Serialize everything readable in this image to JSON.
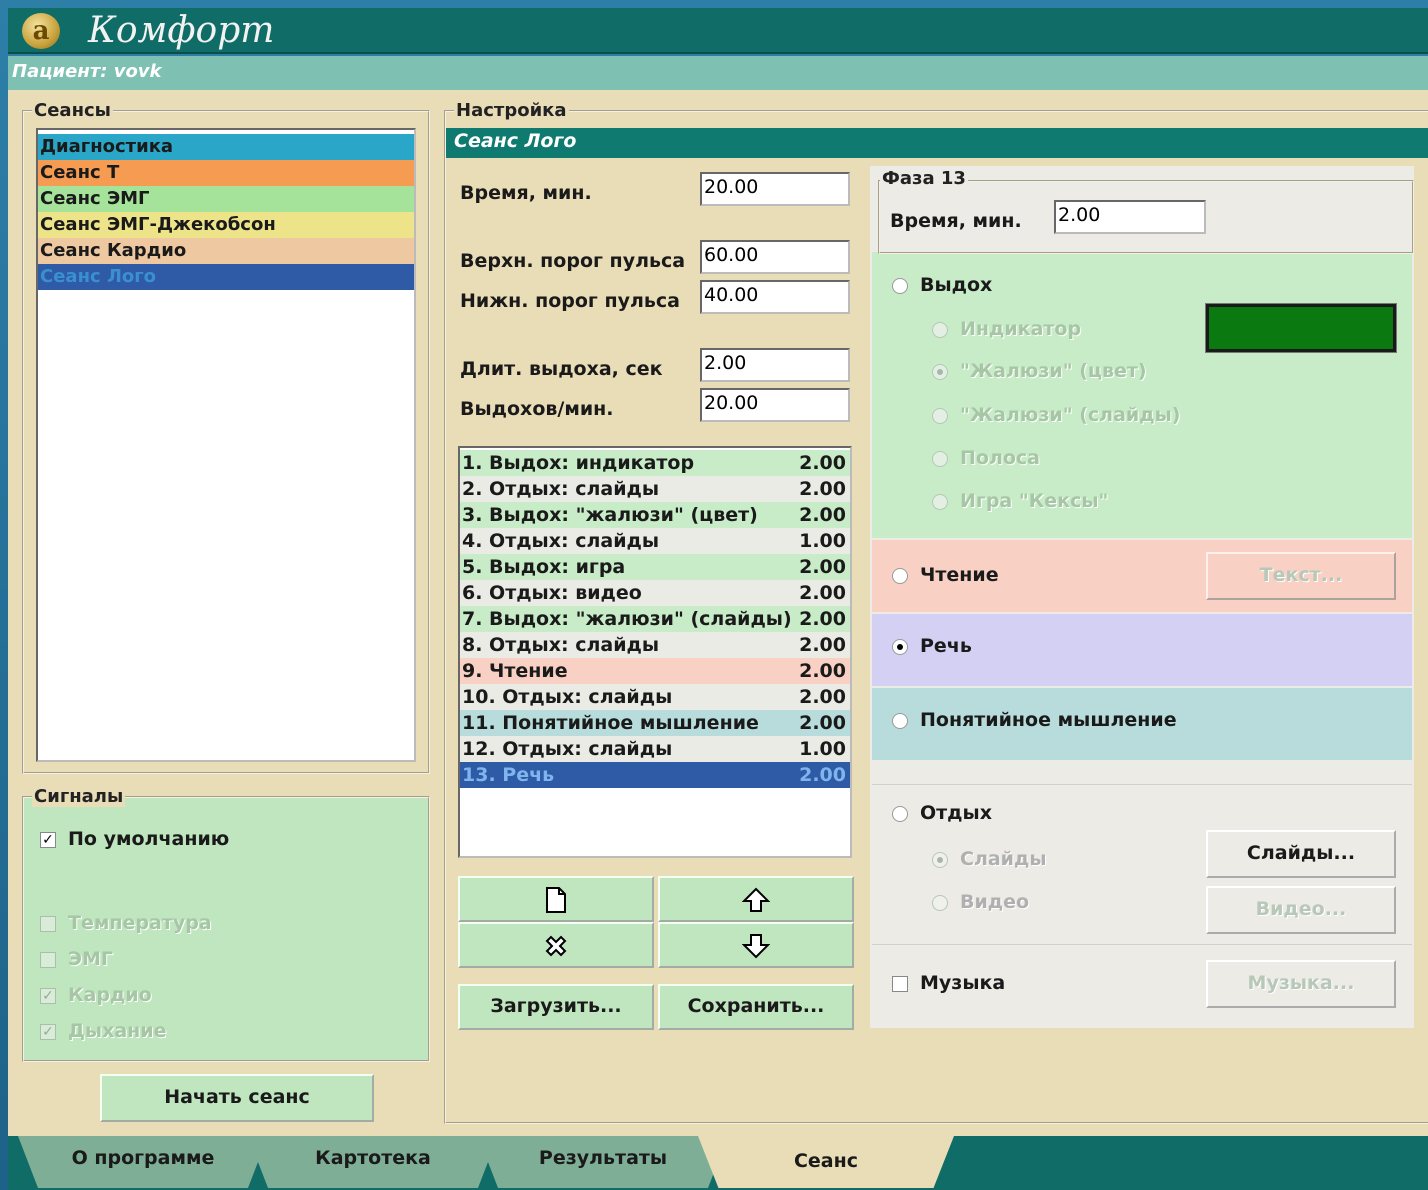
{
  "app": {
    "title": "Комфорт",
    "logo_glyph": "a",
    "patient": "Пациент: vovk"
  },
  "sessions": {
    "title": "Сеансы",
    "items": [
      {
        "label": "Диагностика",
        "color": "#2aa6c8"
      },
      {
        "label": "Сеанс Т",
        "color": "#f59b52"
      },
      {
        "label": "Сеанс ЭМГ",
        "color": "#a6e39a"
      },
      {
        "label": "Сеанс ЭМГ-Джекобсон",
        "color": "#ede48a"
      },
      {
        "label": "Сеанс Кардио",
        "color": "#eec8a0"
      },
      {
        "label": "Сеанс Лого",
        "color": "#2f5aa6",
        "selected": true
      }
    ]
  },
  "signals": {
    "title": "Сигналы",
    "default_label": "По умолчанию",
    "default_checked": true,
    "items": [
      {
        "label": "Температура",
        "checked": false
      },
      {
        "label": "ЭМГ",
        "checked": false
      },
      {
        "label": "Кардио",
        "checked": true
      },
      {
        "label": "Дыхание",
        "checked": true
      }
    ],
    "start_button": "Начать сеанс"
  },
  "settings": {
    "title": "Настройка",
    "header": "Сеанс Лого",
    "fields": {
      "time_label": "Время, мин.",
      "time_value": "20.00",
      "upper_label": "Верхн. порог пульса",
      "upper_value": "60.00",
      "lower_label": "Нижн. порог пульса",
      "lower_value": "40.00",
      "exhale_len_label": "Длит. выдоха, сек",
      "exhale_len_value": "2.00",
      "exhales_label": "Выдохов/мин.",
      "exhales_value": "20.00"
    },
    "phases": [
      {
        "label": "1. Выдох: индикатор",
        "value": "2.00",
        "color": "#c8ecc8"
      },
      {
        "label": "2. Отдых: слайды",
        "value": "2.00",
        "color": "#ebebe6"
      },
      {
        "label": "3. Выдох: \"жалюзи\" (цвет)",
        "value": "2.00",
        "color": "#c8ecc8"
      },
      {
        "label": "4. Отдых: слайды",
        "value": "1.00",
        "color": "#ebebe6"
      },
      {
        "label": "5. Выдох: игра",
        "value": "2.00",
        "color": "#c8ecc8"
      },
      {
        "label": "6. Отдых: видео",
        "value": "2.00",
        "color": "#ebebe6"
      },
      {
        "label": "7. Выдох: \"жалюзи\" (слайды)",
        "value": "2.00",
        "color": "#c8ecc8"
      },
      {
        "label": "8. Отдых: слайды",
        "value": "2.00",
        "color": "#ebebe6"
      },
      {
        "label": "9. Чтение",
        "value": "2.00",
        "color": "#f8d0c4"
      },
      {
        "label": "10. Отдых: слайды",
        "value": "2.00",
        "color": "#ebebe6"
      },
      {
        "label": "11. Понятийное мышление",
        "value": "2.00",
        "color": "#b8dcdc"
      },
      {
        "label": "12. Отдых: слайды",
        "value": "1.00",
        "color": "#ebebe6"
      },
      {
        "label": "13. Речь",
        "value": "2.00",
        "color": "#2f5aa6",
        "selected": true
      }
    ],
    "buttons": {
      "new_icon": "new-document-icon",
      "up_icon": "arrow-up-icon",
      "delete_icon": "delete-x-icon",
      "down_icon": "arrow-down-icon",
      "load": "Загрузить...",
      "save": "Сохранить..."
    }
  },
  "phase": {
    "title": "Фаза 13",
    "time_label": "Время, мин.",
    "time_value": "2.00",
    "exhale": {
      "label": "Выдох",
      "options": [
        "Индикатор",
        "\"Жалюзи\" (цвет)",
        "\"Жалюзи\" (слайды)",
        "Полоса",
        "Игра \"Кексы\""
      ],
      "selected_option": "\"Жалюзи\" (цвет)",
      "swatch_color": "#0a7a10"
    },
    "reading": {
      "label": "Чтение",
      "button": "Текст..."
    },
    "speech": {
      "label": "Речь",
      "selected": true
    },
    "concept": {
      "label": "Понятийное мышление"
    },
    "rest": {
      "label": "Отдых",
      "options": [
        "Слайды",
        "Видео"
      ],
      "selected_option": "Слайды",
      "slides_button": "Слайды...",
      "video_button": "Видео..."
    },
    "music": {
      "label": "Музыка",
      "button": "Музыка..."
    }
  },
  "tabs": [
    {
      "label": "О программе"
    },
    {
      "label": "Картотека"
    },
    {
      "label": "Результаты"
    },
    {
      "label": "Сеанс",
      "active": true
    }
  ]
}
